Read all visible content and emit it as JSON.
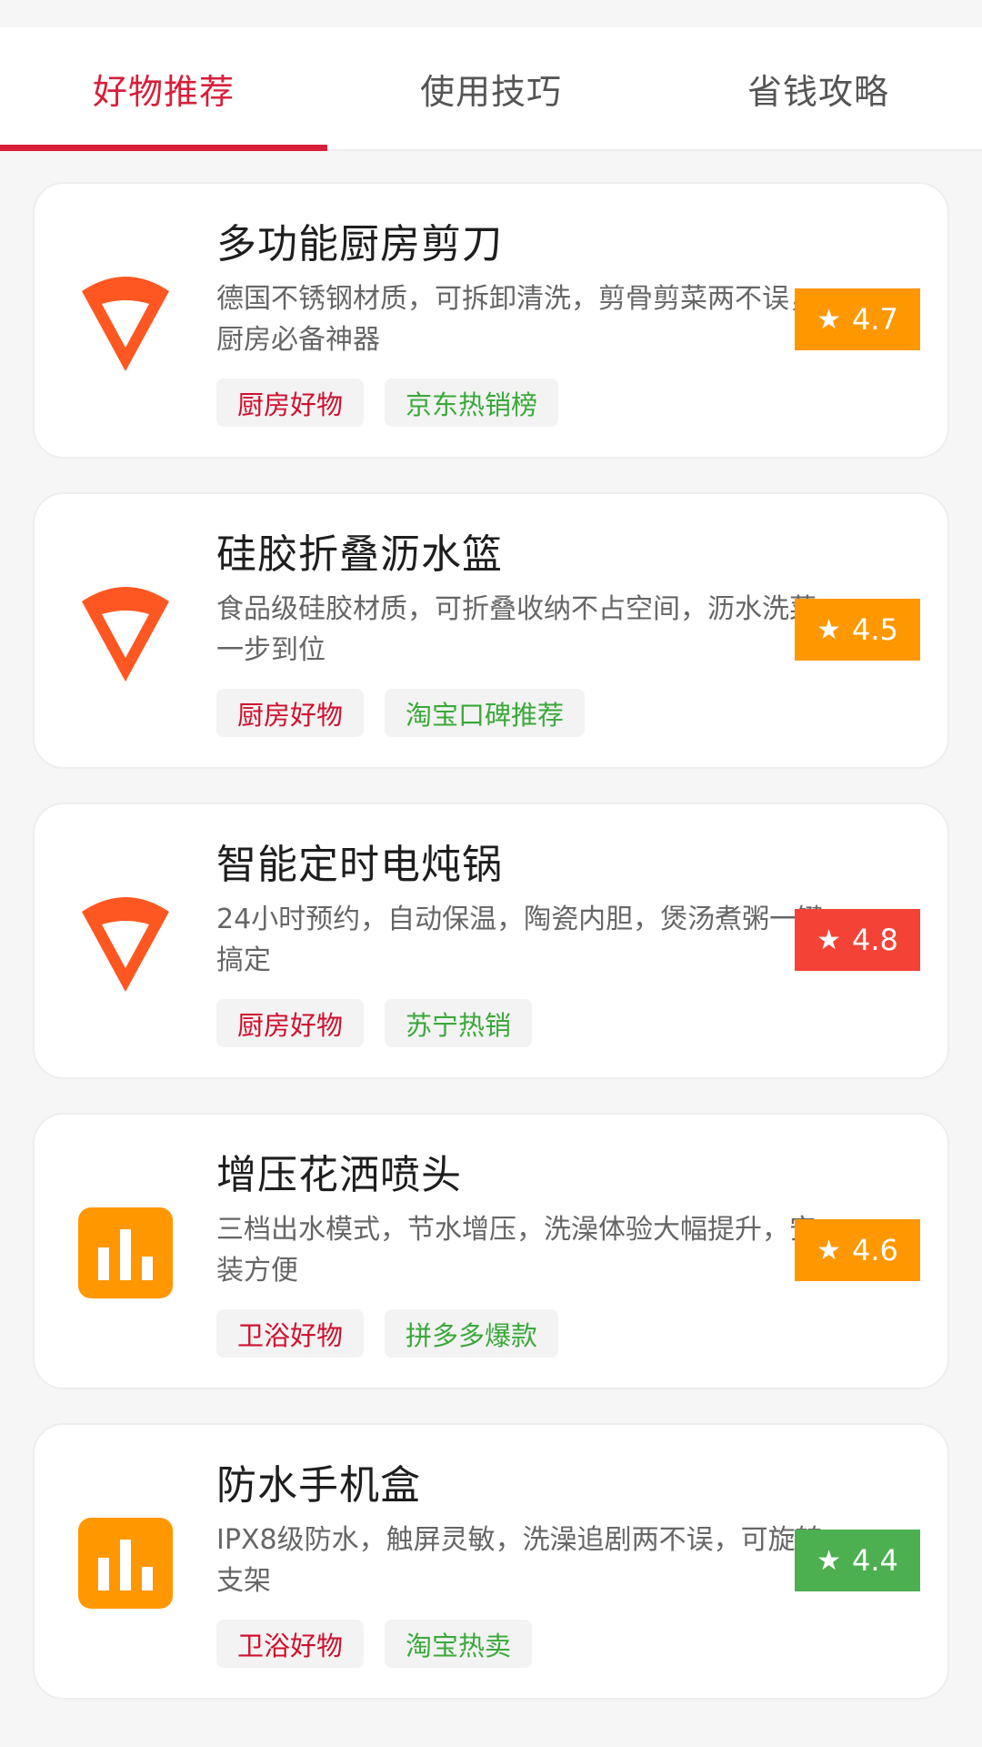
{
  "tabs": [
    {
      "label": "好物推荐",
      "active": true
    },
    {
      "label": "使用技巧",
      "active": false
    },
    {
      "label": "省钱攻略",
      "active": false
    }
  ],
  "items": [
    {
      "title": "多功能厨房剪刀",
      "desc": "德国不锈钢材质，可拆卸清洗，剪骨剪菜两不误，厨房必备神器",
      "tags": [
        "厨房好物",
        "京东热销榜"
      ],
      "rating": "4.7",
      "rating_color": "#ff9800",
      "icon": "wedge-icon"
    },
    {
      "title": "硅胶折叠沥水篮",
      "desc": "食品级硅胶材质，可折叠收纳不占空间，沥水洗菜一步到位",
      "tags": [
        "厨房好物",
        "淘宝口碑推荐"
      ],
      "rating": "4.5",
      "rating_color": "#ff9800",
      "icon": "wedge-icon"
    },
    {
      "title": "智能定时电炖锅",
      "desc": "24小时预约，自动保温，陶瓷内胆，煲汤煮粥一键搞定",
      "tags": [
        "厨房好物",
        "苏宁热销"
      ],
      "rating": "4.8",
      "rating_color": "#f44336",
      "icon": "wedge-icon"
    },
    {
      "title": "增压花洒喷头",
      "desc": "三档出水模式，节水增压，洗澡体验大幅提升，安装方便",
      "tags": [
        "卫浴好物",
        "拼多多爆款"
      ],
      "rating": "4.6",
      "rating_color": "#ff9800",
      "icon": "bar-chart-icon"
    },
    {
      "title": "防水手机盒",
      "desc": "IPX8级防水，触屏灵敏，洗澡追剧两不误，可旋转支架",
      "tags": [
        "卫浴好物",
        "淘宝热卖"
      ],
      "rating": "4.4",
      "rating_color": "#4caf50",
      "icon": "bar-chart-icon"
    }
  ],
  "colors": {
    "accent": "#d81e3a",
    "wedge": "#ff5722",
    "bar_icon": "#ff9800"
  }
}
